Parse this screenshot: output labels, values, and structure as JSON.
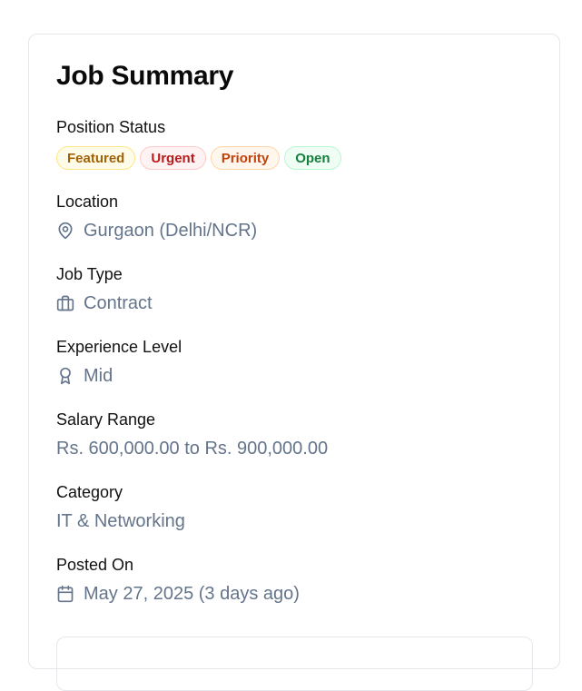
{
  "card": {
    "title": "Job Summary"
  },
  "position_status": {
    "label": "Position Status",
    "badges": [
      {
        "text": "Featured",
        "color": "#a16207",
        "bg": "#fefce8",
        "border": "#fde68a"
      },
      {
        "text": "Urgent",
        "color": "#b91c1c",
        "bg": "#fef2f2",
        "border": "#fecaca"
      },
      {
        "text": "Priority",
        "color": "#c2410c",
        "bg": "#fff7ed",
        "border": "#fed7aa"
      },
      {
        "text": "Open",
        "color": "#15803d",
        "bg": "#f0fdf4",
        "border": "#bbf7d0"
      }
    ]
  },
  "location": {
    "label": "Location",
    "value": "Gurgaon (Delhi/NCR)",
    "icon": "map-pin-icon"
  },
  "job_type": {
    "label": "Job Type",
    "value": "Contract",
    "icon": "briefcase-icon"
  },
  "experience": {
    "label": "Experience Level",
    "value": "Mid",
    "icon": "award-icon"
  },
  "salary": {
    "label": "Salary Range",
    "value": "Rs. 600,000.00 to Rs. 900,000.00"
  },
  "category": {
    "label": "Category",
    "value": "IT & Networking"
  },
  "posted": {
    "label": "Posted On",
    "value": "May 27, 2025 (3 days ago)",
    "icon": "calendar-icon"
  }
}
